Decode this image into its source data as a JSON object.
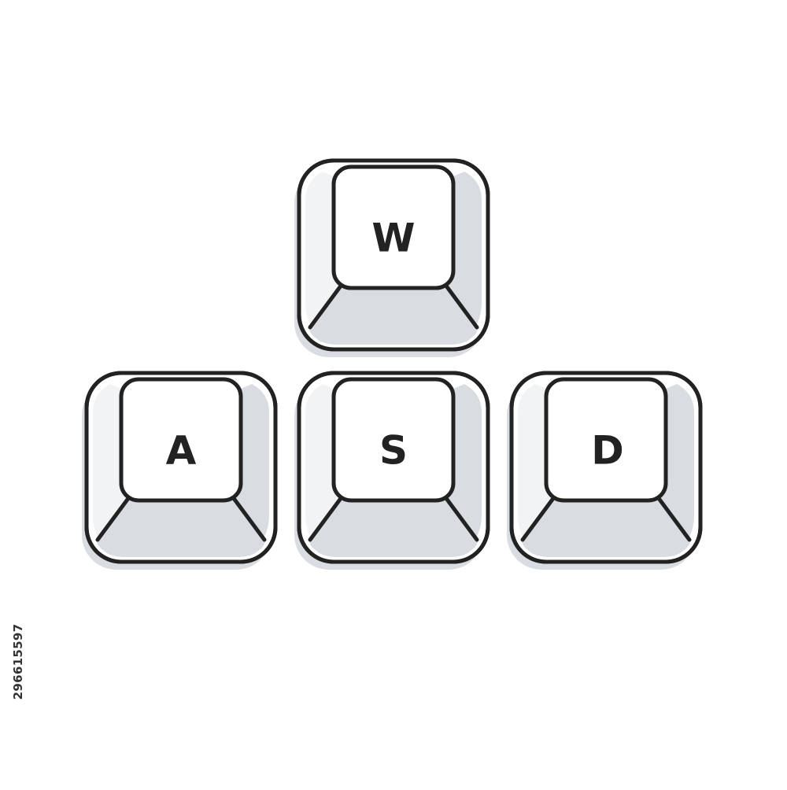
{
  "keys": [
    {
      "id": "w",
      "label": "W"
    },
    {
      "id": "a",
      "label": "A"
    },
    {
      "id": "s",
      "label": "S"
    },
    {
      "id": "d",
      "label": "D"
    }
  ],
  "side_id": "296615597",
  "colors": {
    "background": "#ffffff",
    "outline": "#222222",
    "key_face": "#ffffff",
    "key_skirt": "#d9dde2",
    "key_shadow": "#d9dde2"
  },
  "icons": [
    "keycap-w-icon",
    "keycap-a-icon",
    "keycap-s-icon",
    "keycap-d-icon"
  ]
}
